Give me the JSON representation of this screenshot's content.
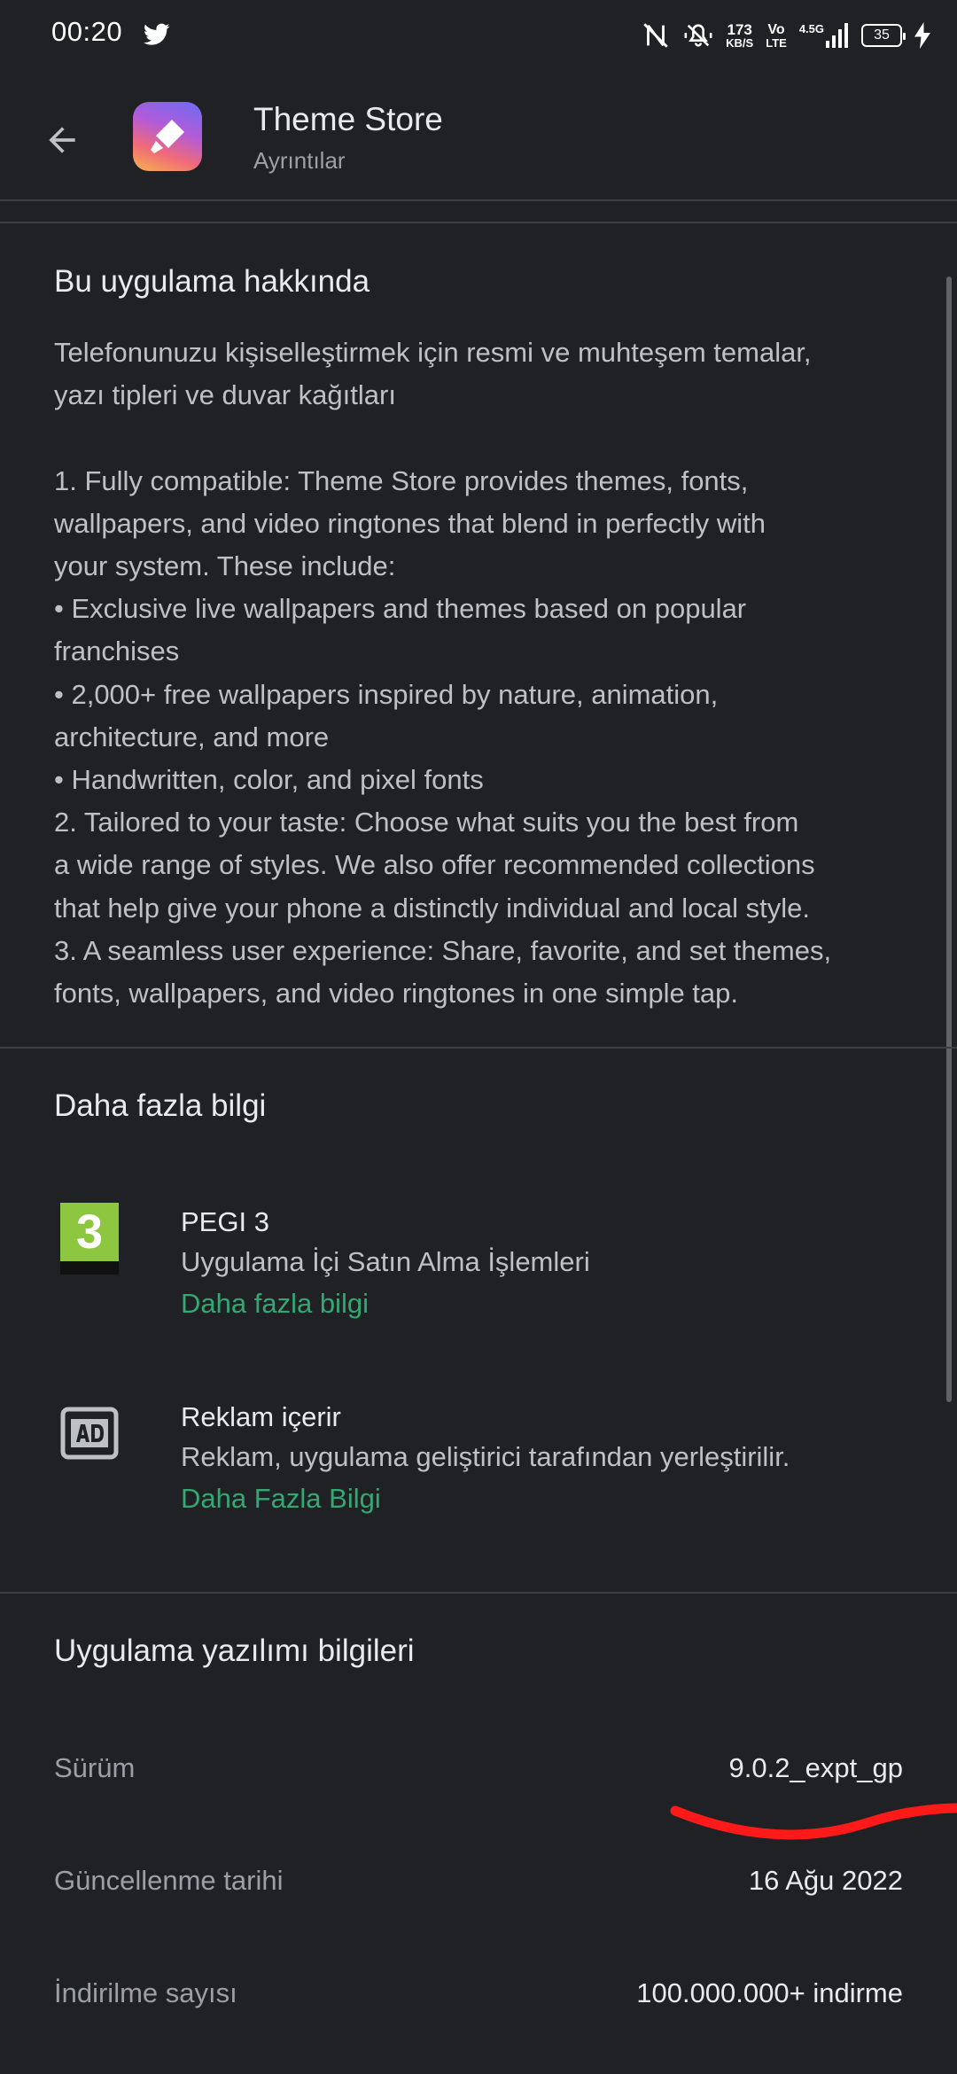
{
  "status_bar": {
    "time": "00:20",
    "speed_value": "173",
    "speed_unit": "KB/S",
    "volte_top": "Vo",
    "volte_bottom": "LTE",
    "network": "4.5G",
    "battery": "35",
    "icons": [
      "twitter-icon",
      "nfc-icon",
      "vibrate-icon",
      "signal-icon",
      "charging-icon"
    ]
  },
  "header": {
    "title": "Theme Store",
    "subtitle": "Ayrıntılar"
  },
  "about": {
    "title": "Bu uygulama hakkında",
    "text": "Telefonunuzu kişiselleştirmek için resmi ve muhteşem temalar,\nyazı tipleri ve duvar kağıtları\n\n1. Fully compatible: Theme Store provides themes, fonts,\nwallpapers, and video ringtones that blend in perfectly with\nyour system. These include:\n• Exclusive live wallpapers and themes based on popular\nfranchises\n• 2,000+ free wallpapers inspired by nature, animation,\narchitecture, and more\n• Handwritten, color, and pixel fonts\n2. Tailored to your taste: Choose what suits you the best from\na wide range of styles. We also offer recommended collections\nthat help give your phone a distinctly individual and local style.\n3. A seamless user experience: Share, favorite, and set themes,\nfonts, wallpapers, and video ringtones in one simple tap."
  },
  "more_info": {
    "title": "Daha fazla bilgi",
    "items": [
      {
        "badge": "3",
        "title": "PEGI 3",
        "desc": "Uygulama İçi Satın Alma İşlemleri",
        "link": "Daha fazla bilgi"
      },
      {
        "title": "Reklam içerir",
        "desc": "Reklam, uygulama geliştirici tarafından yerleştirilir.",
        "link": "Daha Fazla Bilgi"
      }
    ]
  },
  "software": {
    "title": "Uygulama yazılımı bilgileri",
    "rows": [
      {
        "key": "Sürüm",
        "value": "9.0.2_expt_gp"
      },
      {
        "key": "Güncellenme tarihi",
        "value": "16 Ağu 2022"
      },
      {
        "key": "İndirilme sayısı",
        "value": "100.000.000+ indirme"
      }
    ]
  },
  "colors": {
    "background": "#202124",
    "link": "#34a873",
    "annotation": "#ff1a1a"
  }
}
